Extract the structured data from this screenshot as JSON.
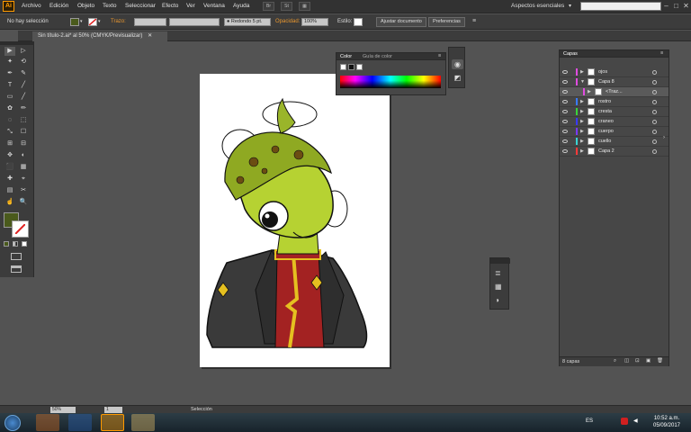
{
  "app": {
    "logo": "Ai"
  },
  "menu": [
    "Archivo",
    "Edición",
    "Objeto",
    "Texto",
    "Seleccionar",
    "Efecto",
    "Ver",
    "Ventana",
    "Ayuda"
  ],
  "menubar_buttons": [
    "Br",
    "St"
  ],
  "workspace": "Aspectos esenciales",
  "window_controls": [
    "–",
    "□",
    "✕"
  ],
  "control": {
    "selection": "No hay selección",
    "stroke_label": "Trazo:",
    "brush_value": "Redondo 5 pt.",
    "opacity_label": "Opacidad:",
    "opacity_value": "100%",
    "style_label": "Estilo:",
    "doc_setup": "Ajustar documento",
    "prefs": "Preferencias"
  },
  "doc_tab": {
    "title": "Sin título-2.ai* al 50% (CMYK/Previsualizar)",
    "close": "✕"
  },
  "tools": [
    "▶",
    "▷",
    "✦",
    "⟲",
    "✒",
    "✎",
    "T",
    "╱",
    "▭",
    "╱",
    "✿",
    "✏",
    "◌",
    "⬚",
    "⤡",
    "☐",
    "⊞",
    "⊟",
    "✥",
    "◐",
    "⬛",
    "▦",
    "✚",
    "⌖",
    "▤",
    "✂",
    "☝",
    "🔍"
  ],
  "color_panel": {
    "tabs": [
      "Color",
      "Guía de color"
    ]
  },
  "layers_panel": {
    "title": "Capas",
    "count": "8 capas",
    "layers": [
      {
        "name": "ojos",
        "color": "#e04ce0",
        "indent": 0,
        "expanded": false
      },
      {
        "name": "Capa 8",
        "color": "#e04ce0",
        "indent": 0,
        "expanded": true
      },
      {
        "name": "<Traz...",
        "color": "#e04ce0",
        "indent": 1,
        "expanded": false
      },
      {
        "name": "rostro",
        "color": "#3a7bff",
        "indent": 0,
        "expanded": false
      },
      {
        "name": "cresta",
        "color": "#3ad43a",
        "indent": 0,
        "expanded": false
      },
      {
        "name": "craneo",
        "color": "#3a3aff",
        "indent": 0,
        "expanded": false
      },
      {
        "name": "cuerpo",
        "color": "#7a3aff",
        "indent": 0,
        "expanded": false
      },
      {
        "name": "cuello",
        "color": "#3ad4d4",
        "indent": 0,
        "expanded": false
      },
      {
        "name": "Capa 2",
        "color": "#ff3a3a",
        "indent": 0,
        "expanded": false
      }
    ]
  },
  "status": {
    "zoom": "50%",
    "page": "1",
    "tool": "Selección"
  },
  "taskbar": {
    "lang": "ES",
    "time": "10:52 a.m.",
    "date": "05/09/2017"
  },
  "colors": {
    "accent": "#ff9a00",
    "panel": "#474747",
    "ui": "#535353",
    "fill": "#4a5a1c"
  }
}
